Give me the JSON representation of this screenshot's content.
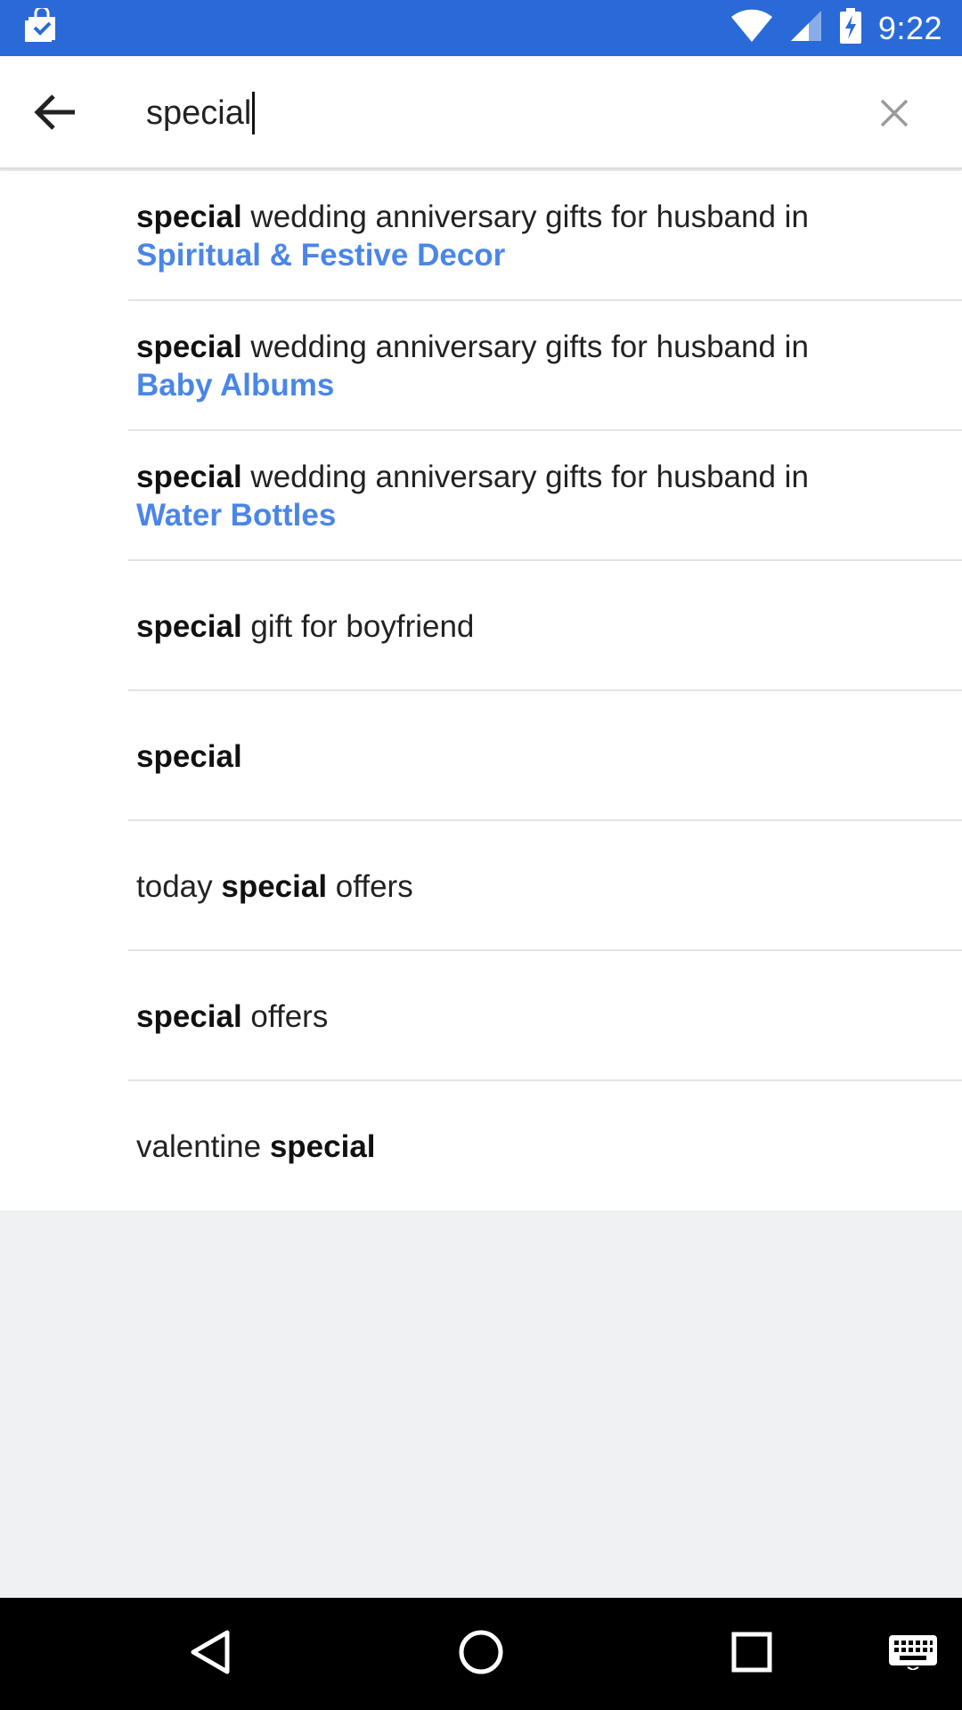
{
  "colors": {
    "status_bar": "#2a6ad8",
    "category_link": "#4a86e8",
    "background": "#f0f1f3"
  },
  "status_bar": {
    "time": "9:22",
    "icons": [
      "shopping-bag-notification-icon",
      "wifi-icon",
      "cellular-signal-icon",
      "battery-charging-icon"
    ]
  },
  "search": {
    "value": "special",
    "back_icon": "arrow-left-icon",
    "clear_icon": "close-icon"
  },
  "suggestions": [
    {
      "prefix": "",
      "keyword": "special",
      "suffix": " wedding anniversary gifts for husband in",
      "category": "Spiritual & Festive Decor"
    },
    {
      "prefix": "",
      "keyword": "special",
      "suffix": " wedding anniversary gifts for husband in",
      "category": "Baby Albums"
    },
    {
      "prefix": "",
      "keyword": "special",
      "suffix": " wedding anniversary gifts for husband in",
      "category": "Water Bottles"
    },
    {
      "prefix": "",
      "keyword": "special",
      "suffix": " gift for boyfriend",
      "category": ""
    },
    {
      "prefix": "",
      "keyword": "special",
      "suffix": "",
      "category": ""
    },
    {
      "prefix": "today ",
      "keyword": "special",
      "suffix": " offers",
      "category": ""
    },
    {
      "prefix": "",
      "keyword": "special",
      "suffix": " offers",
      "category": ""
    },
    {
      "prefix": "valentine ",
      "keyword": "special",
      "suffix": "",
      "category": ""
    }
  ],
  "nav_bar": {
    "icons": [
      "back-triangle-icon",
      "home-circle-icon",
      "recents-square-icon",
      "keyboard-icon"
    ]
  }
}
